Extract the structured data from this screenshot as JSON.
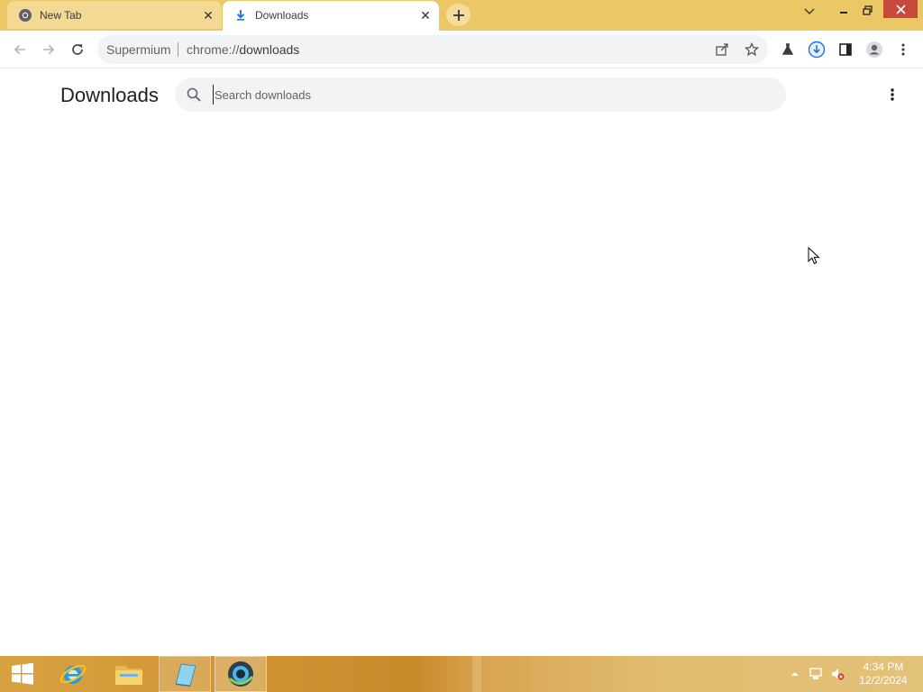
{
  "browser": {
    "tabs": [
      {
        "title": "New Tab",
        "active": false
      },
      {
        "title": "Downloads",
        "active": true
      }
    ],
    "omnibox": {
      "site_name": "Supermium",
      "url_scheme": "chrome://",
      "url_path": "downloads"
    }
  },
  "page": {
    "title": "Downloads",
    "search": {
      "placeholder": "Search downloads",
      "value": ""
    }
  },
  "taskbar": {
    "clock": {
      "time": "4:34 PM",
      "date": "12/2/2024"
    }
  },
  "colors": {
    "frame": "#ecc766",
    "close_button": "#c7493c",
    "download_accent": "#1a73e8"
  }
}
